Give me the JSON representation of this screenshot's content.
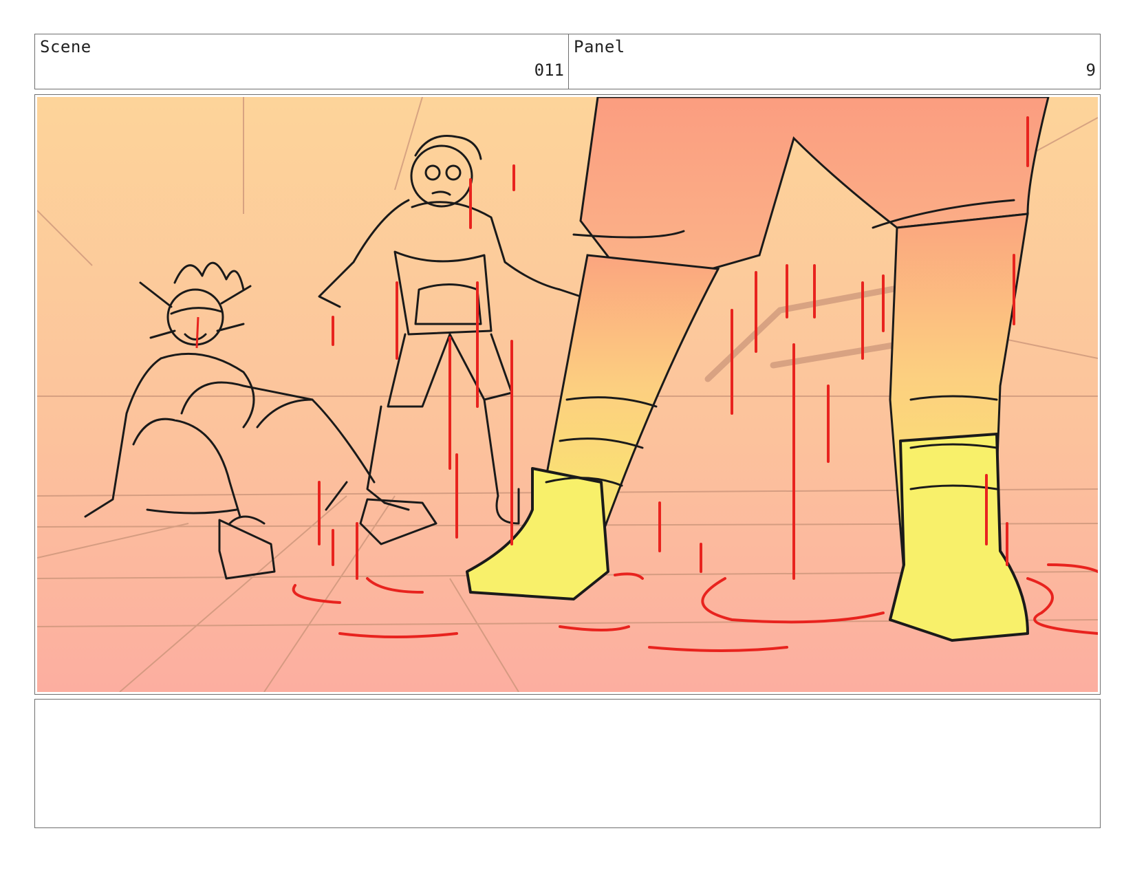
{
  "header": {
    "scene_label": "Scene",
    "scene_value": "011",
    "panel_label": "Panel",
    "panel_value": "9"
  },
  "frame": {
    "sky_top_color": "#fdd49a",
    "floor_color": "#fcb3a0",
    "boot_color": "#f8f06a",
    "liquid_color": "#e8231e"
  },
  "notes": {
    "text": ""
  }
}
